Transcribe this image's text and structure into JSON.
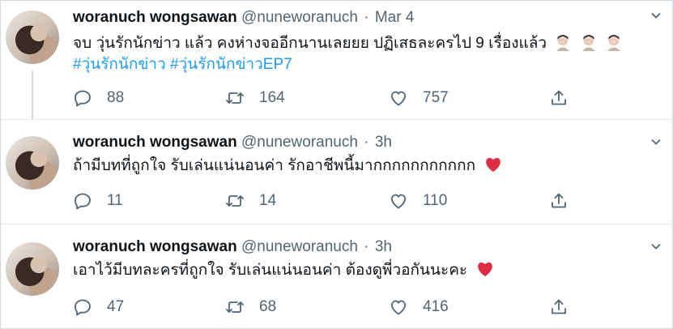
{
  "tweets": [
    {
      "name": "woranuch wongsawan",
      "handle": "@nuneworanuch",
      "separator": "·",
      "time": "Mar 4",
      "text": "จบ วุ่นรักนักข่าว แล้ว คงห่างจออีกนานเลยยย ปฏิเสธละครไป 9 เรื่องแล้ว",
      "hashtags": "#วุ่นรักนักข่าว #วุ่นรักนักข่าวEP7",
      "emoji": "facepalm-emoji",
      "replies": "88",
      "retweets": "164",
      "likes": "757"
    },
    {
      "name": "woranuch wongsawan",
      "handle": "@nuneworanuch",
      "separator": "·",
      "time": "3h",
      "text": "ถ้ามีบทที่ถูกใจ รับเล่นแน่นอนค่า รักอาชีพนี้มากกกกกกกกกกก",
      "emoji": "red-heart-emoji",
      "replies": "11",
      "retweets": "14",
      "likes": "110"
    },
    {
      "name": "woranuch wongsawan",
      "handle": "@nuneworanuch",
      "separator": "·",
      "time": "3h",
      "text": "เอาไว้มีบทละครที่ถูกใจ รับเล่นแน่นอนค่า ต้องดูพี่วอกันนะคะ",
      "emoji": "red-heart-emoji",
      "replies": "47",
      "retweets": "68",
      "likes": "416"
    }
  ],
  "colors": {
    "link": "#1d9bf0",
    "secondary": "#536471",
    "divider": "#e1e8ed",
    "heart": "#dd2e44"
  },
  "icons": [
    "chevron-down-icon",
    "reply-icon",
    "retweet-icon",
    "like-icon",
    "share-icon"
  ]
}
